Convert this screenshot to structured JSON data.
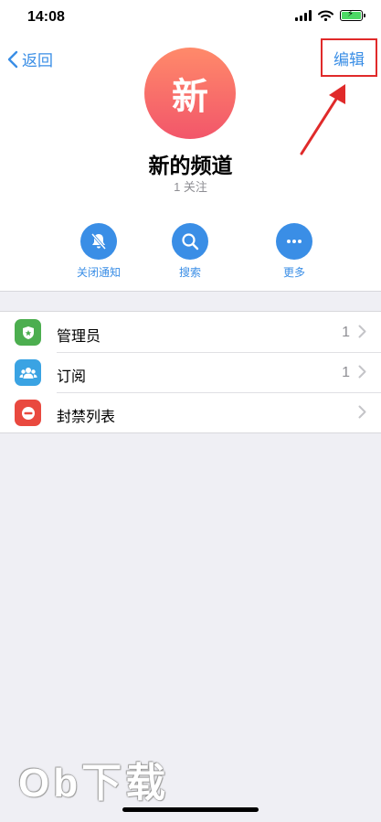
{
  "status_bar": {
    "time": "14:08"
  },
  "nav": {
    "back_label": "返回",
    "edit_label": "编辑"
  },
  "channel": {
    "avatar_text": "新",
    "name": "新的频道",
    "subscribers": "1 关注"
  },
  "actions": [
    {
      "label": "关闭通知",
      "icon": "bell-slash-icon"
    },
    {
      "label": "搜索",
      "icon": "search-icon"
    },
    {
      "label": "更多",
      "icon": "more-icon"
    }
  ],
  "list": [
    {
      "title": "管理员",
      "count": "1",
      "icon": "admin-shield-icon",
      "color": "#4cae4f"
    },
    {
      "title": "订阅",
      "count": "1",
      "icon": "subscribers-icon",
      "color": "#3aa3e3"
    },
    {
      "title": "封禁列表",
      "count": "",
      "icon": "ban-icon",
      "color": "#e9493f"
    }
  ],
  "watermark": "Ob下载",
  "colors": {
    "accent": "#3a8ee6",
    "highlight_box": "#e02a2a"
  }
}
